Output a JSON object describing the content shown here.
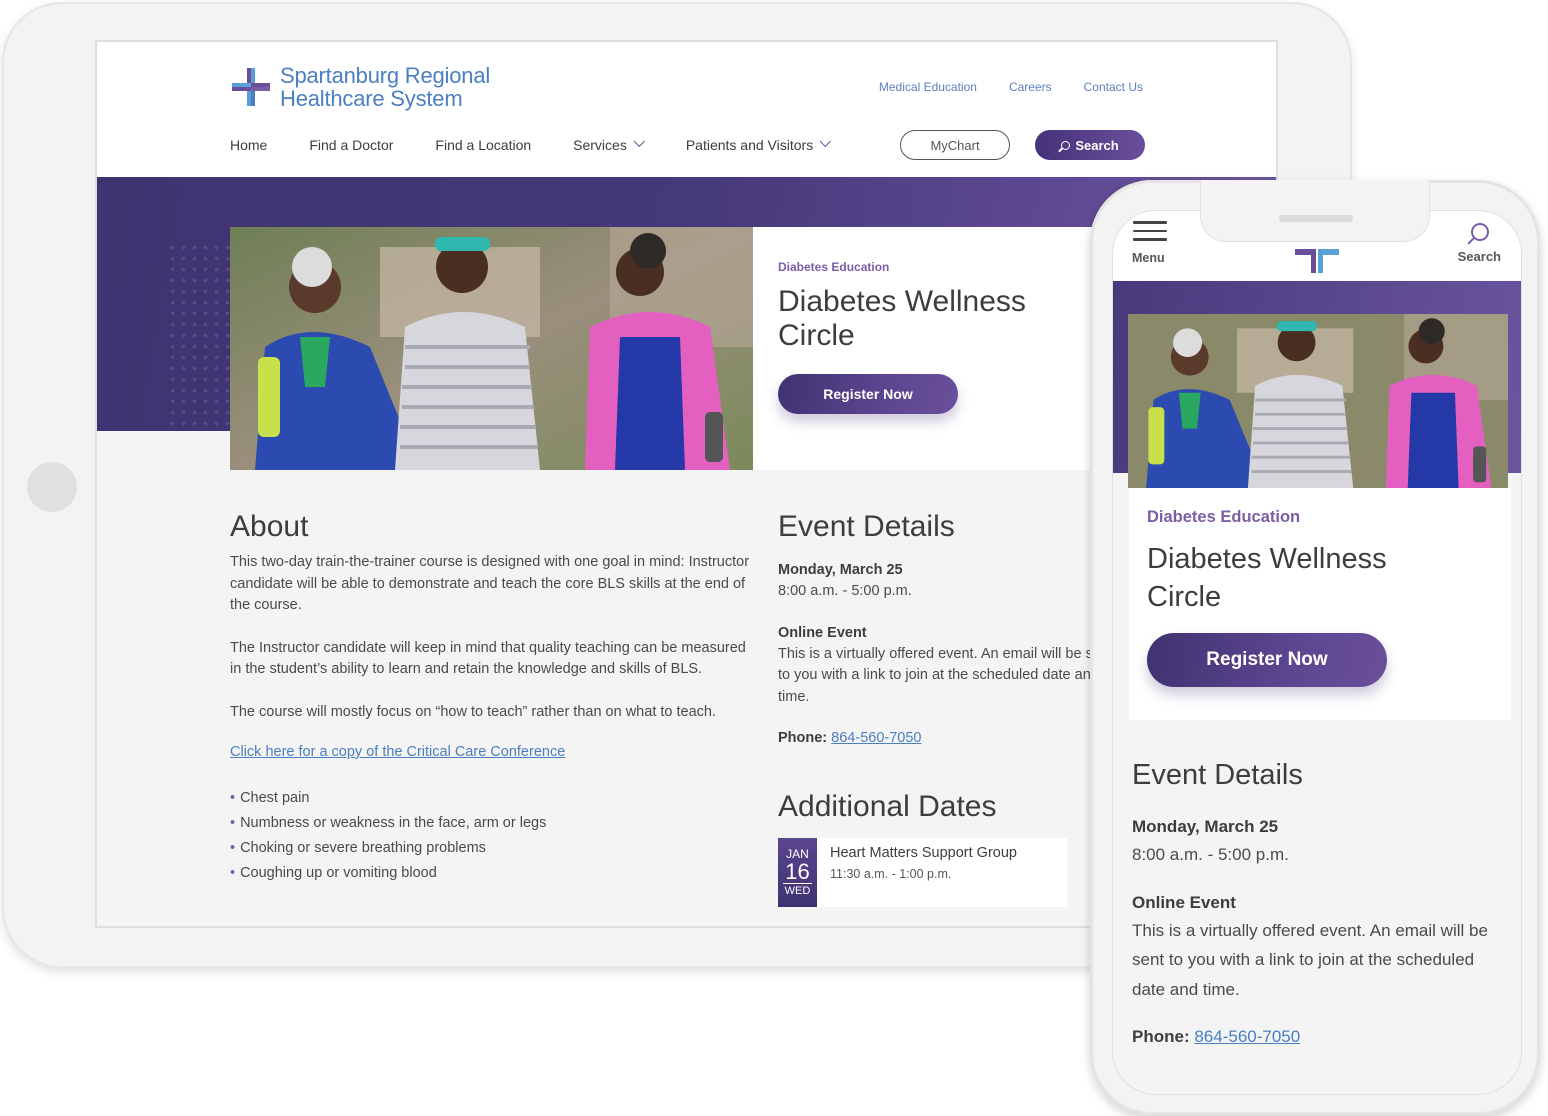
{
  "site": {
    "name_line1": "Spartanburg Regional",
    "name_line2": "Healthcare System"
  },
  "utility_nav": [
    "Medical Education",
    "Careers",
    "Contact Us"
  ],
  "main_nav": [
    {
      "label": "Home",
      "dropdown": false
    },
    {
      "label": "Find a Doctor",
      "dropdown": false
    },
    {
      "label": "Find a Location",
      "dropdown": false
    },
    {
      "label": "Services",
      "dropdown": true
    },
    {
      "label": "Patients and Visitors",
      "dropdown": true
    }
  ],
  "buttons": {
    "mychart": "MyChart",
    "search": "Search",
    "register": "Register Now"
  },
  "hero": {
    "eyebrow": "Diabetes Education",
    "title": "Diabetes Wellness Circle"
  },
  "about": {
    "heading": "About",
    "paragraphs": [
      "This two-day train-the-trainer course is designed with one goal in mind: Instructor candidate will be able to demonstrate and teach the core BLS skills at the end of the course.",
      "The Instructor candidate will keep in mind that quality teaching can be measured in the student’s ability to learn and retain the knowledge and skills of BLS.",
      "The course will mostly focus on “how to teach” rather than on what to teach."
    ],
    "link": "Click here for a copy of the Critical Care Conference",
    "bullets": [
      "Chest pain",
      "Numbness or weakness in the face, arm or legs",
      "Choking or severe breathing problems",
      "Coughing up or vomiting blood"
    ]
  },
  "event_details": {
    "heading": "Event Details",
    "date": "Monday, March 25",
    "time": "8:00 a.m. - 5:00 p.m.",
    "online_label": "Online Event",
    "online_text": "This is a virtually offered event. An email will be sent to you with a link to join at the scheduled date and time.",
    "phone_label": "Phone:",
    "phone": "864-560-7050"
  },
  "additional_dates": {
    "heading": "Additional Dates",
    "items": [
      {
        "month": "JAN",
        "day": "16",
        "weekday": "WED",
        "title": "Heart Matters Support Group",
        "time": "11:30 a.m. - 1:00 p.m."
      }
    ]
  },
  "mobile": {
    "menu_label": "Menu",
    "search_label": "Search"
  },
  "colors": {
    "brand_purple": "#45337a",
    "accent_purple": "#7b5ea7",
    "link_blue": "#4a7fc1"
  }
}
